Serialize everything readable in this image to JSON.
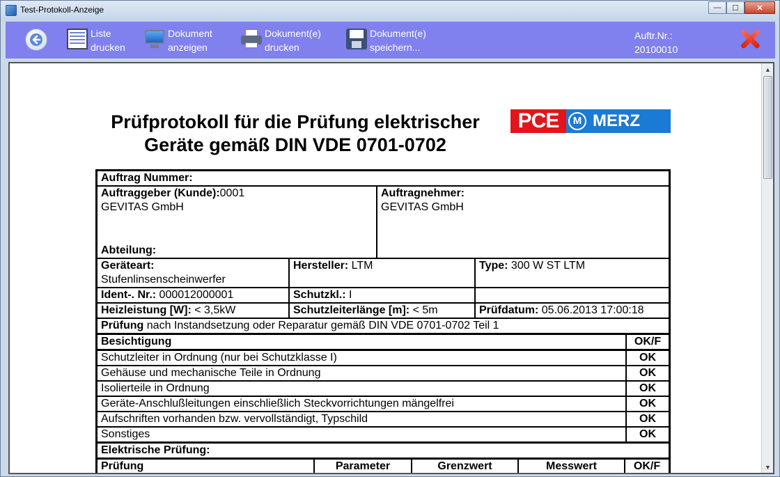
{
  "window": {
    "title": "Test-Protokoll-Anzeige"
  },
  "toolbar": {
    "list_print": [
      "Liste",
      "drucken"
    ],
    "doc_show": [
      "Dokument",
      "anzeigen"
    ],
    "doc_print": [
      "Dokument(e)",
      "drucken"
    ],
    "doc_save": [
      "Dokument(e)",
      "speichern..."
    ],
    "auftr_label": "Auftr.Nr.:",
    "auftr_value": "20100010"
  },
  "document": {
    "title_line1": "Prüfprotokoll für die Prüfung elektrischer",
    "title_line2": "Geräte gemäß DIN VDE 0701-0702",
    "logo": {
      "pce": "PCE",
      "m": "M",
      "merz": "MERZ"
    },
    "auftrag_nummer_label": "Auftrag Nummer:",
    "auftraggeber_label": "Auftraggeber (Kunde):",
    "auftraggeber_nr": "0001",
    "auftraggeber_name": "GEVITAS GmbH",
    "auftragnehmer_label": "Auftragnehmer:",
    "auftragnehmer_name": "GEVITAS GmbH",
    "abteilung_label": "Abteilung:",
    "geraeteart_label": "Geräteart:",
    "geraeteart_value": "Stufenlinsenscheinwerfer",
    "hersteller_label": "Hersteller:",
    "hersteller_value": " LTM",
    "type_label": "Type:",
    "type_value": " 300 W ST LTM",
    "ident_label": "Ident-. Nr.:",
    "ident_value": " 000012000001",
    "schutzkl_label": "Schutzkl.:",
    "schutzkl_value": " I",
    "heiz_label": "Heizleistung [W]:",
    "heiz_value": " < 3,5kW",
    "schutzleiter_label": "Schutzleiterlänge [m]:",
    "schutzleiter_value": " < 5m",
    "pruefdatum_label": "Prüfdatum:",
    "pruefdatum_value": " 05.06.2013 17:00:18",
    "pruefung_label": "Prüfung",
    "pruefung_text": " nach Instandsetzung oder Reparatur gemäß DIN VDE 0701-0702 Teil 1",
    "besichtigung_label": "Besichtigung",
    "okf_label": "OK/F",
    "besichtigung_items": [
      {
        "text": "Schutzleiter in Ordnung (nur bei Schutzklasse I)",
        "result": "OK"
      },
      {
        "text": "Gehäuse und mechanische Teile in Ordnung",
        "result": "OK"
      },
      {
        "text": "Isolierteile in Ordnung",
        "result": "OK"
      },
      {
        "text": "Geräte-Anschlußleitungen einschließlich Steckvorrichtungen mängelfrei",
        "result": "OK"
      },
      {
        "text": "Aufschriften vorhanden bzw. vervollständigt, Typschild",
        "result": "OK"
      },
      {
        "text": "Sonstiges",
        "result": "OK"
      }
    ],
    "elektrische_label": "Elektrische Prüfung:",
    "elektrische_headers": [
      "Prüfung",
      "Parameter",
      "Grenzwert",
      "Messwert",
      "OK/F"
    ]
  }
}
